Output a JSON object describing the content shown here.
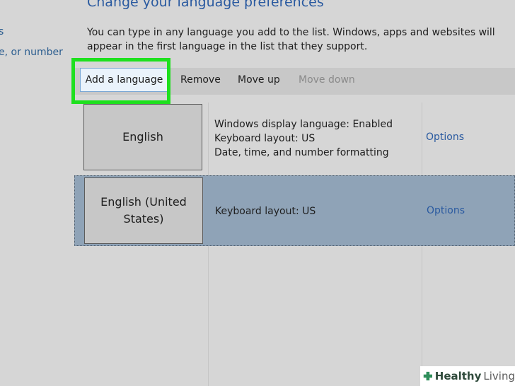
{
  "left_nav": {
    "items": [
      {
        "label": "s"
      },
      {
        "label": "e, or number"
      }
    ]
  },
  "header": {
    "title": "Change your language preferences",
    "description": "You can type in any language you add to the list. Windows, apps and websites will appear in the first language in the list that they support."
  },
  "toolbar": {
    "add_label": "Add a language",
    "remove_label": "Remove",
    "move_up_label": "Move up",
    "move_down_label": "Move down"
  },
  "languages": [
    {
      "name": "English",
      "details": [
        "Windows display language: Enabled",
        "Keyboard layout: US",
        "Date, time, and number formatting"
      ],
      "options_label": "Options"
    },
    {
      "name": "English (United States)",
      "details": [
        "Keyboard layout: US"
      ],
      "options_label": "Options"
    }
  ],
  "colors": {
    "highlight": "#1ee01e",
    "selected_row": "#8fa3b7",
    "link": "#2a5aa0"
  },
  "watermark": {
    "brand_bold": "Healthy",
    "brand_light": "Living",
    "icon": "plus-leaf-icon"
  }
}
